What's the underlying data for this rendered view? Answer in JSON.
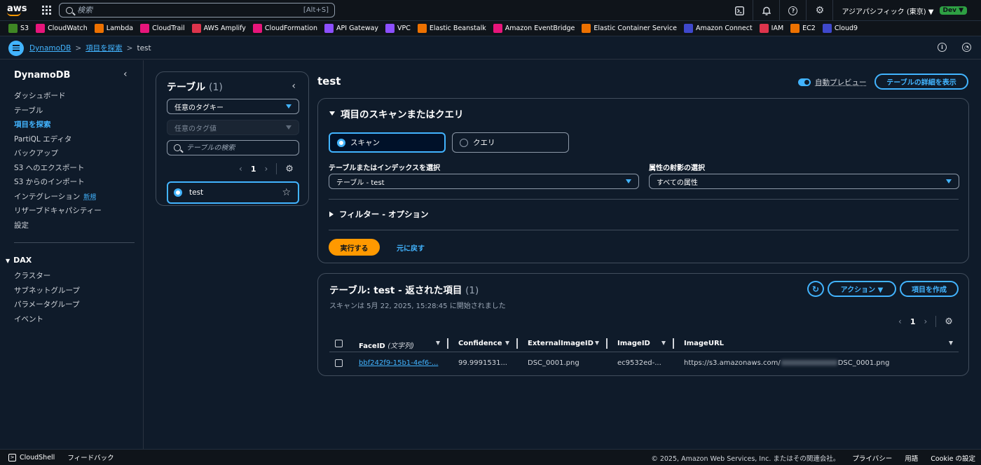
{
  "topnav": {
    "logo": "aws",
    "search_placeholder": "検索",
    "search_shortcut": "[Alt+S]",
    "region": "アジアパシフィック (東京) ▼",
    "account_badge": "Dev ▼"
  },
  "favorites": [
    {
      "label": "S3",
      "color": "#3f8624"
    },
    {
      "label": "CloudWatch",
      "color": "#e7157b"
    },
    {
      "label": "Lambda",
      "color": "#ed7100"
    },
    {
      "label": "CloudTrail",
      "color": "#e7157b"
    },
    {
      "label": "AWS Amplify",
      "color": "#dd344c"
    },
    {
      "label": "CloudFormation",
      "color": "#e7157b"
    },
    {
      "label": "API Gateway",
      "color": "#8c4fff"
    },
    {
      "label": "VPC",
      "color": "#8c4fff"
    },
    {
      "label": "Elastic Beanstalk",
      "color": "#ed7100"
    },
    {
      "label": "Amazon EventBridge",
      "color": "#e7157b"
    },
    {
      "label": "Elastic Container Service",
      "color": "#ed7100"
    },
    {
      "label": "Amazon Connect",
      "color": "#3f48cc"
    },
    {
      "label": "IAM",
      "color": "#dd344c"
    },
    {
      "label": "EC2",
      "color": "#ed7100"
    },
    {
      "label": "Cloud9",
      "color": "#3f48cc"
    }
  ],
  "breadcrumb": {
    "items": [
      "DynamoDB",
      "項目を探索"
    ],
    "current": "test"
  },
  "sidebar": {
    "title": "DynamoDB",
    "items": [
      {
        "label": "ダッシュボード"
      },
      {
        "label": "テーブル"
      },
      {
        "label": "項目を探索"
      },
      {
        "label": "PartiQL エディタ"
      },
      {
        "label": "バックアップ"
      },
      {
        "label": "S3 へのエクスポート"
      },
      {
        "label": "S3 からのインポート"
      },
      {
        "label": "インテグレーション"
      },
      {
        "label": "リザーブドキャパシティー"
      },
      {
        "label": "設定"
      }
    ],
    "new_badge": "新規",
    "dax_title": "DAX",
    "dax_items": [
      {
        "label": "クラスター"
      },
      {
        "label": "サブネットグループ"
      },
      {
        "label": "パラメータグループ"
      },
      {
        "label": "イベント"
      }
    ]
  },
  "tables_panel": {
    "title": "テーブル",
    "count": "(1)",
    "tag_key": "任意のタグキー",
    "tag_value": "任意のタグ値",
    "search_placeholder": "テーブルの検索",
    "page": "1",
    "selected_table": "test"
  },
  "main": {
    "title": "test",
    "auto_preview": "自動プレビュー",
    "details_button": "テーブルの詳細を表示"
  },
  "scan": {
    "header": "項目のスキャンまたはクエリ",
    "scan_label": "スキャン",
    "query_label": "クエリ",
    "table_select_label": "テーブルまたはインデックスを選択",
    "table_select_value": "テーブル - test",
    "projection_label": "属性の射影の選択",
    "projection_value": "すべての属性",
    "filter_label": "フィルター - オプション",
    "run_button": "実行する",
    "reset_button": "元に戻す"
  },
  "results": {
    "title": "テーブル: test - 返された項目",
    "count": "(1)",
    "subtitle": "スキャンは 5月 22, 2025, 15:28:45 に開始されました",
    "actions_button": "アクション ▼",
    "create_button": "項目を作成",
    "page": "1",
    "columns": [
      {
        "label": "FaceID",
        "type": "(文字列)"
      },
      {
        "label": "Confidence"
      },
      {
        "label": "ExternalImageID"
      },
      {
        "label": "ImageID"
      },
      {
        "label": "ImageURL"
      }
    ],
    "rows": [
      {
        "faceid": "bbf242f9-15b1-4ef6-...",
        "confidence": "99.9991531...",
        "external": "DSC_0001.png",
        "imageid": "ec9532ed-...",
        "url_prefix": "https://s3.amazonaws.com/",
        "url_suffix": "DSC_0001.png"
      }
    ]
  },
  "footer": {
    "cloudshell": "CloudShell",
    "feedback": "フィードバック",
    "copyright": "© 2025, Amazon Web Services, Inc. またはその関連会社。",
    "privacy": "プライバシー",
    "terms": "用語",
    "cookie": "Cookie の設定"
  }
}
